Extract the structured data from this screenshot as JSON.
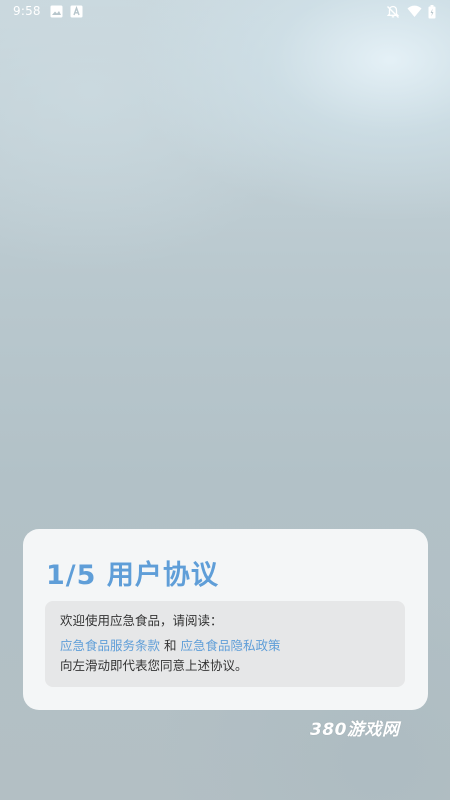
{
  "status_bar": {
    "time": "9:58",
    "icons": [
      "image-icon",
      "font-a-icon",
      "notifications-off-icon",
      "wifi-icon",
      "battery-icon"
    ]
  },
  "agreement_card": {
    "title": "1/5 用户协议",
    "intro": "欢迎使用应急食品，请阅读：",
    "service_terms_link": "应急食品服务条款",
    "conjunction": "和",
    "privacy_policy_link": "应急食品隐私政策",
    "swipe_notice": "向左滑动即代表您同意上述协议。"
  },
  "watermark": "380游戏网",
  "colors": {
    "accent": "#5f9ed8",
    "card_background": "#f4f6f7",
    "notice_background": "#e6e7e8"
  }
}
